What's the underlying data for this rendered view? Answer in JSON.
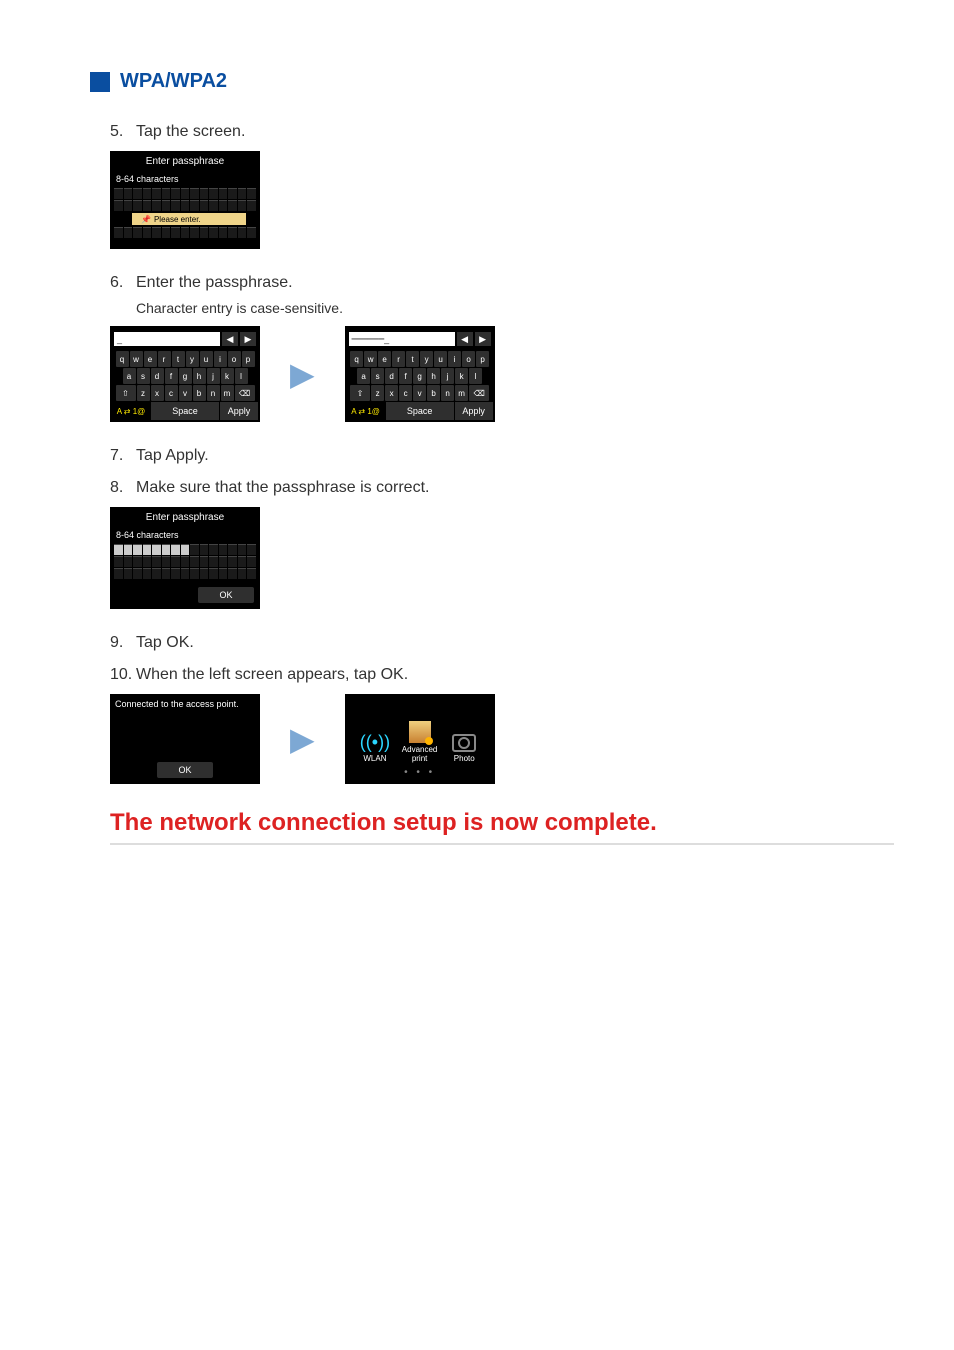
{
  "section_title": "WPA/WPA2",
  "steps": {
    "5": "Tap the screen.",
    "6": "Enter the passphrase.",
    "6_sub": "Character entry is case-sensitive.",
    "7": "Tap Apply.",
    "8": "Make sure that the passphrase is correct.",
    "9": "Tap OK.",
    "10": "When the left screen appears, tap OK."
  },
  "screen_passphrase": {
    "title": "Enter passphrase",
    "chars": "8-64 characters",
    "tooltip": "Please enter."
  },
  "keyboard": {
    "row1": [
      "q",
      "w",
      "e",
      "r",
      "t",
      "y",
      "u",
      "i",
      "o",
      "p"
    ],
    "row2": [
      "a",
      "s",
      "d",
      "f",
      "g",
      "h",
      "j",
      "k",
      "l"
    ],
    "row3": [
      "⇧",
      "z",
      "x",
      "c",
      "v",
      "b",
      "n",
      "m",
      "⌫"
    ],
    "mode": "A ⇄ 1@",
    "space": "Space",
    "apply": "Apply"
  },
  "confirm_screen": {
    "title": "Enter passphrase",
    "chars": "8-64 characters",
    "ok": "OK"
  },
  "connect_screen": {
    "msg": "Connected to the access point.",
    "ok": "OK"
  },
  "home_screen": {
    "wlan": "WLAN",
    "advanced": "Advanced print",
    "photo": "Photo"
  },
  "completion": "The network connection setup is now complete.",
  "kb_input_initial": "_",
  "kb_input_filled": "———"
}
